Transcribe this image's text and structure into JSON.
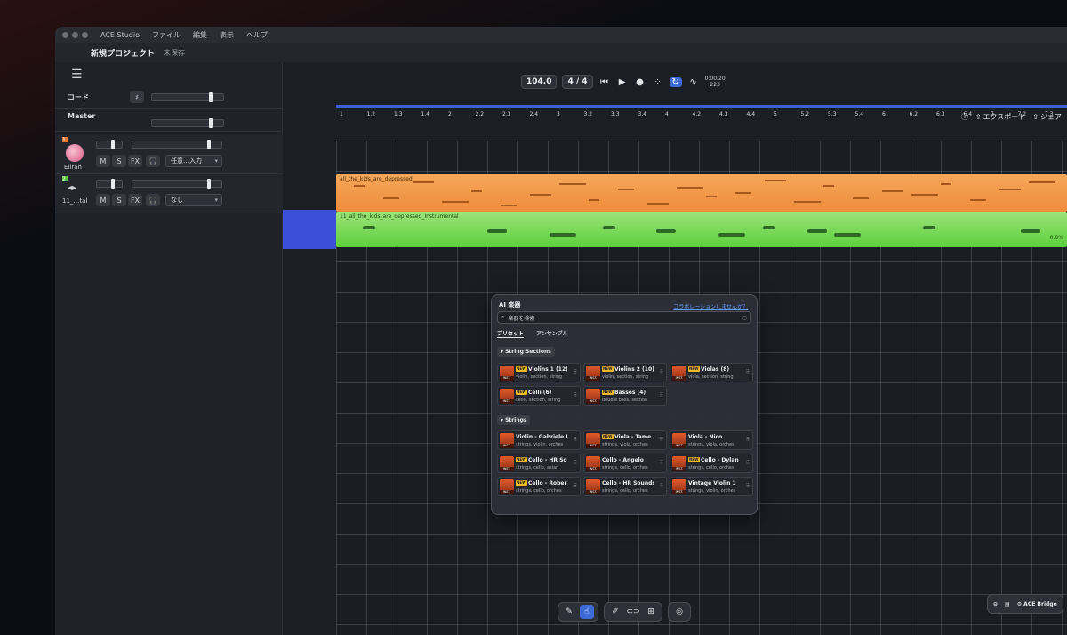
{
  "menubar": {
    "items": [
      "ACE Studio",
      "ファイル",
      "編集",
      "表示",
      "ヘルプ"
    ]
  },
  "project": {
    "title": "新規プロジェクト",
    "saved": "未保存"
  },
  "left": {
    "chord_label": "コード",
    "master_label": "Master",
    "tracks": [
      {
        "num": "1",
        "name": "Elirah",
        "select": "任意…入力"
      },
      {
        "num": "2",
        "name": "11_…tal",
        "select": "なし"
      }
    ],
    "buttons": {
      "mute": "M",
      "solo": "S",
      "fx": "FX",
      "headphones": "🎧"
    }
  },
  "transport": {
    "tempo": "104.0",
    "meter": "4 / 4",
    "time_top": "0:00:20",
    "time_bottom": "223"
  },
  "header_actions": {
    "export": "エクスポート",
    "share": "シェア"
  },
  "ruler": {
    "bars": [
      "1",
      "1.2",
      "1.3",
      "1.4",
      "2",
      "2.2",
      "2.3",
      "2.4",
      "3",
      "3.2",
      "3.3",
      "3.4",
      "4",
      "4.2",
      "4.3",
      "4.4",
      "5",
      "5.2",
      "5.3",
      "5.4",
      "6",
      "6.2",
      "6.3",
      "6.4",
      "7",
      "7.2",
      "7.3"
    ]
  },
  "regions": {
    "vocal": "all_the_kids_are_depressed",
    "instrumental": "11_all_the_kids_are_depressed_Instrumental",
    "inst_end_label": "0.0%"
  },
  "ai_panel": {
    "title": "AI 楽器",
    "link": "コラボレーションしませんか？",
    "search_placeholder": "楽器を検索",
    "tabs": [
      "プリセット",
      "アンサンブル"
    ],
    "section1": "String Sections",
    "section2": "Strings",
    "section1_cards": [
      {
        "name": "Violins 1 (12)",
        "desc": "violin, section, string",
        "new": true
      },
      {
        "name": "Violins 2 (10)",
        "desc": "violin, section, string",
        "new": true
      },
      {
        "name": "Violas (8)",
        "desc": "viola, section, string",
        "new": true
      },
      {
        "name": "Celli (6)",
        "desc": "cello, section, string",
        "new": true
      },
      {
        "name": "Basses (4)",
        "desc": "double bass, section",
        "new": true
      }
    ],
    "section2_cards": [
      {
        "name": "Violin - Gabriele B",
        "desc": "strings, violin, orches",
        "new": false
      },
      {
        "name": "Viola - Tame",
        "desc": "strings, viola, orches",
        "new": true
      },
      {
        "name": "Viola - Nico",
        "desc": "strings, viola, orches",
        "new": false
      },
      {
        "name": "Cello - HR So",
        "desc": "strings, cello, asian",
        "new": true
      },
      {
        "name": "Cello - Angelo",
        "desc": "strings, cello, orches",
        "new": false
      },
      {
        "name": "Cello - Dylan",
        "desc": "strings, cello, orches",
        "new": true
      },
      {
        "name": "Cello - Rober",
        "desc": "strings, cello, orches",
        "new": true
      },
      {
        "name": "Cello - HR Sounds",
        "desc": "strings, cello, orches",
        "new": false
      },
      {
        "name": "Vintage Violin 1",
        "desc": "strings, violin, orches",
        "new": false
      }
    ],
    "new_badge": "NEW",
    "inst_tag": "INST."
  },
  "bridge": {
    "label": "ACE Bridge"
  },
  "colors": {
    "vocal": "#f08f3e",
    "instrumental": "#6fd84a",
    "accent": "#3d6bd6"
  }
}
